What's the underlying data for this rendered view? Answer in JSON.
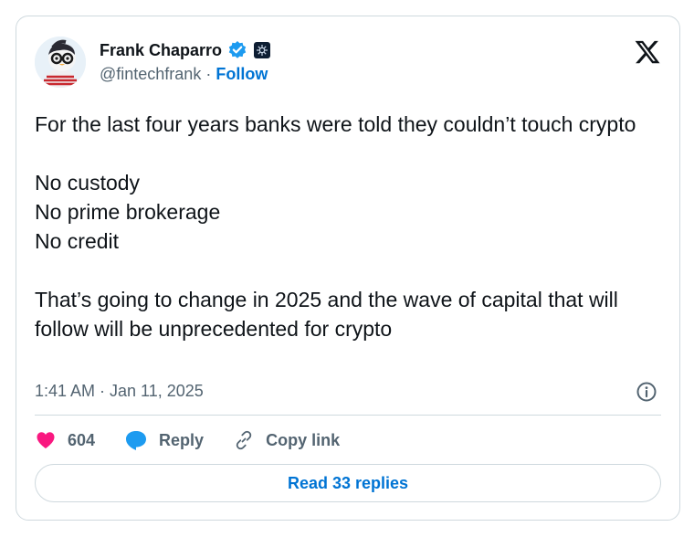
{
  "author": {
    "name": "Frank Chaparro",
    "handle": "@fintechfrank",
    "separator": "·",
    "follow_label": "Follow",
    "verified_color": "#1d9bf0",
    "avatar_icon": "penguin-avatar",
    "affiliation_icon": "affiliate-badge"
  },
  "platform_icon": "x-logo",
  "tweet": {
    "lines": [
      "For the last four years banks were told they couldn’t touch crypto",
      "",
      "No custody",
      "No prime brokerage",
      "No credit",
      "",
      "That’s going to change in 2025 and the wave of capital that will follow will be unprecedented for crypto"
    ]
  },
  "timestamp": "1:41 AM · Jan 11, 2025",
  "actions": {
    "like_count": "604",
    "reply_label": "Reply",
    "copy_link_label": "Copy link"
  },
  "read_replies_label": "Read 33 replies",
  "colors": {
    "like": "#f91880",
    "reply": "#1d9bf0",
    "link": "#0074d4",
    "muted": "#536471",
    "border": "#cfd9de"
  }
}
